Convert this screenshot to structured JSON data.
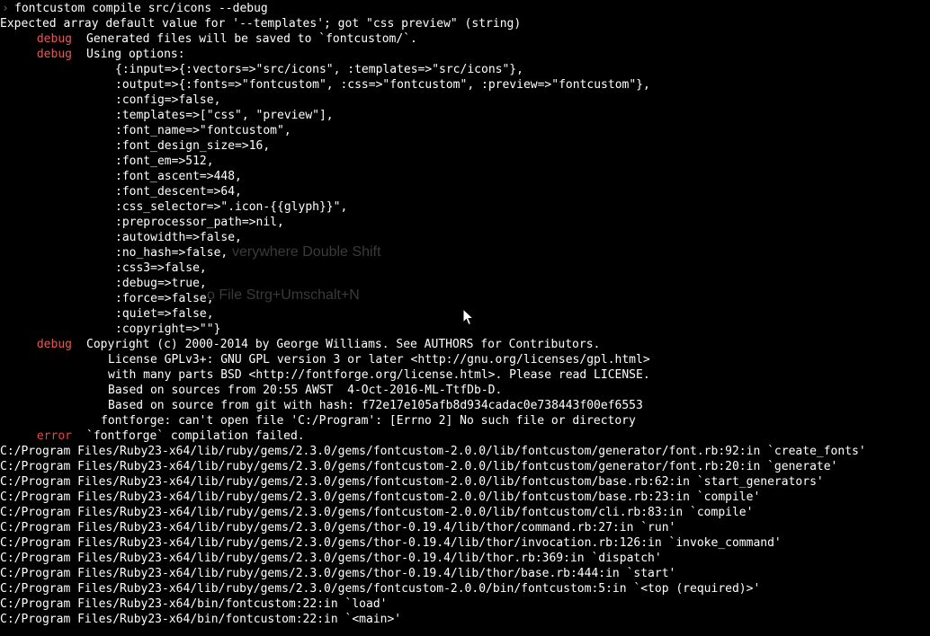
{
  "terminal": {
    "prompt_symbol": "›",
    "command": "fontcustom compile src/icons --debug",
    "warning": "Expected array default value for '--templates'; got \"css preview\" (string)",
    "debug_tag": "debug",
    "error_tag": "error",
    "debug_generated": "Generated files will be saved to `fontcustom/`.",
    "debug_using": "Using options:",
    "options": [
      "{:input=>{:vectors=>\"src/icons\", :templates=>\"src/icons\"},",
      ":output=>{:fonts=>\"fontcustom\", :css=>\"fontcustom\", :preview=>\"fontcustom\"},",
      ":config=>false,",
      ":templates=>[\"css\", \"preview\"],",
      ":font_name=>\"fontcustom\",",
      ":font_design_size=>16,",
      ":font_em=>512,",
      ":font_ascent=>448,",
      ":font_descent=>64,",
      ":css_selector=>\".icon-{{glyph}}\",",
      ":preprocessor_path=>nil,",
      ":autowidth=>false,",
      ":no_hash=>false,",
      ":css3=>false,",
      ":debug=>true,",
      ":force=>false,",
      ":quiet=>false,",
      ":copyright=>\"\"}"
    ],
    "debug_copyright": "Copyright (c) 2000-2014 by George Williams. See AUTHORS for Contributors.",
    "license_lines": [
      "License GPLv3+: GNU GPL version 3 or later <http://gnu.org/licenses/gpl.html>",
      "with many parts BSD <http://fontforge.org/license.html>. Please read LICENSE.",
      "Based on sources from 20:55 AWST  4-Oct-2016-ML-TtfDb-D.",
      "Based on source from git with hash: f72e17e105afb8d934cadac0e738443f00ef6553"
    ],
    "fontforge_error": "fontforge: can't open file 'C:/Program': [Errno 2] No such file or directory",
    "error_message": "`fontforge` compilation failed.",
    "stack_trace": [
      "C:/Program Files/Ruby23-x64/lib/ruby/gems/2.3.0/gems/fontcustom-2.0.0/lib/fontcustom/generator/font.rb:92:in `create_fonts'",
      "C:/Program Files/Ruby23-x64/lib/ruby/gems/2.3.0/gems/fontcustom-2.0.0/lib/fontcustom/generator/font.rb:20:in `generate'",
      "C:/Program Files/Ruby23-x64/lib/ruby/gems/2.3.0/gems/fontcustom-2.0.0/lib/fontcustom/base.rb:62:in `start_generators'",
      "C:/Program Files/Ruby23-x64/lib/ruby/gems/2.3.0/gems/fontcustom-2.0.0/lib/fontcustom/base.rb:23:in `compile'",
      "C:/Program Files/Ruby23-x64/lib/ruby/gems/2.3.0/gems/fontcustom-2.0.0/lib/fontcustom/cli.rb:83:in `compile'",
      "C:/Program Files/Ruby23-x64/lib/ruby/gems/2.3.0/gems/thor-0.19.4/lib/thor/command.rb:27:in `run'",
      "C:/Program Files/Ruby23-x64/lib/ruby/gems/2.3.0/gems/thor-0.19.4/lib/thor/invocation.rb:126:in `invoke_command'",
      "C:/Program Files/Ruby23-x64/lib/ruby/gems/2.3.0/gems/thor-0.19.4/lib/thor.rb:369:in `dispatch'",
      "C:/Program Files/Ruby23-x64/lib/ruby/gems/2.3.0/gems/thor-0.19.4/lib/thor/base.rb:444:in `start'",
      "C:/Program Files/Ruby23-x64/lib/ruby/gems/2.3.0/gems/fontcustom-2.0.0/bin/fontcustom:5:in `<top (required)>'",
      "C:/Program Files/Ruby23-x64/bin/fontcustom:22:in `load'",
      "C:/Program Files/Ruby23-x64/bin/fontcustom:22:in `<main>'"
    ]
  },
  "background_hints": [
    "verywhere  Double Shift",
    "o File  Strg+Umschalt+N"
  ],
  "colors": {
    "background": "#000000",
    "text": "#ffffff",
    "tag": "#e05a5a",
    "prompt": "#6b6b6b"
  }
}
